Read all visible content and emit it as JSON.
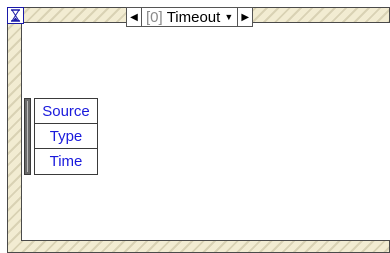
{
  "event_structure": {
    "case_index": "[0]",
    "case_name": "Timeout",
    "event_data_node": {
      "items": [
        {
          "label": "Source"
        },
        {
          "label": "Type"
        },
        {
          "label": "Time"
        }
      ]
    }
  },
  "icons": {
    "timeout": "hourglass-icon",
    "prev": "left-arrow-icon",
    "next": "right-arrow-icon",
    "dropdown": "dropdown-triangle-icon"
  },
  "colors": {
    "terminal_label": "#1a1adc",
    "hatch_light": "#f2ecd2",
    "hatch_dark": "#d9d2b4"
  }
}
